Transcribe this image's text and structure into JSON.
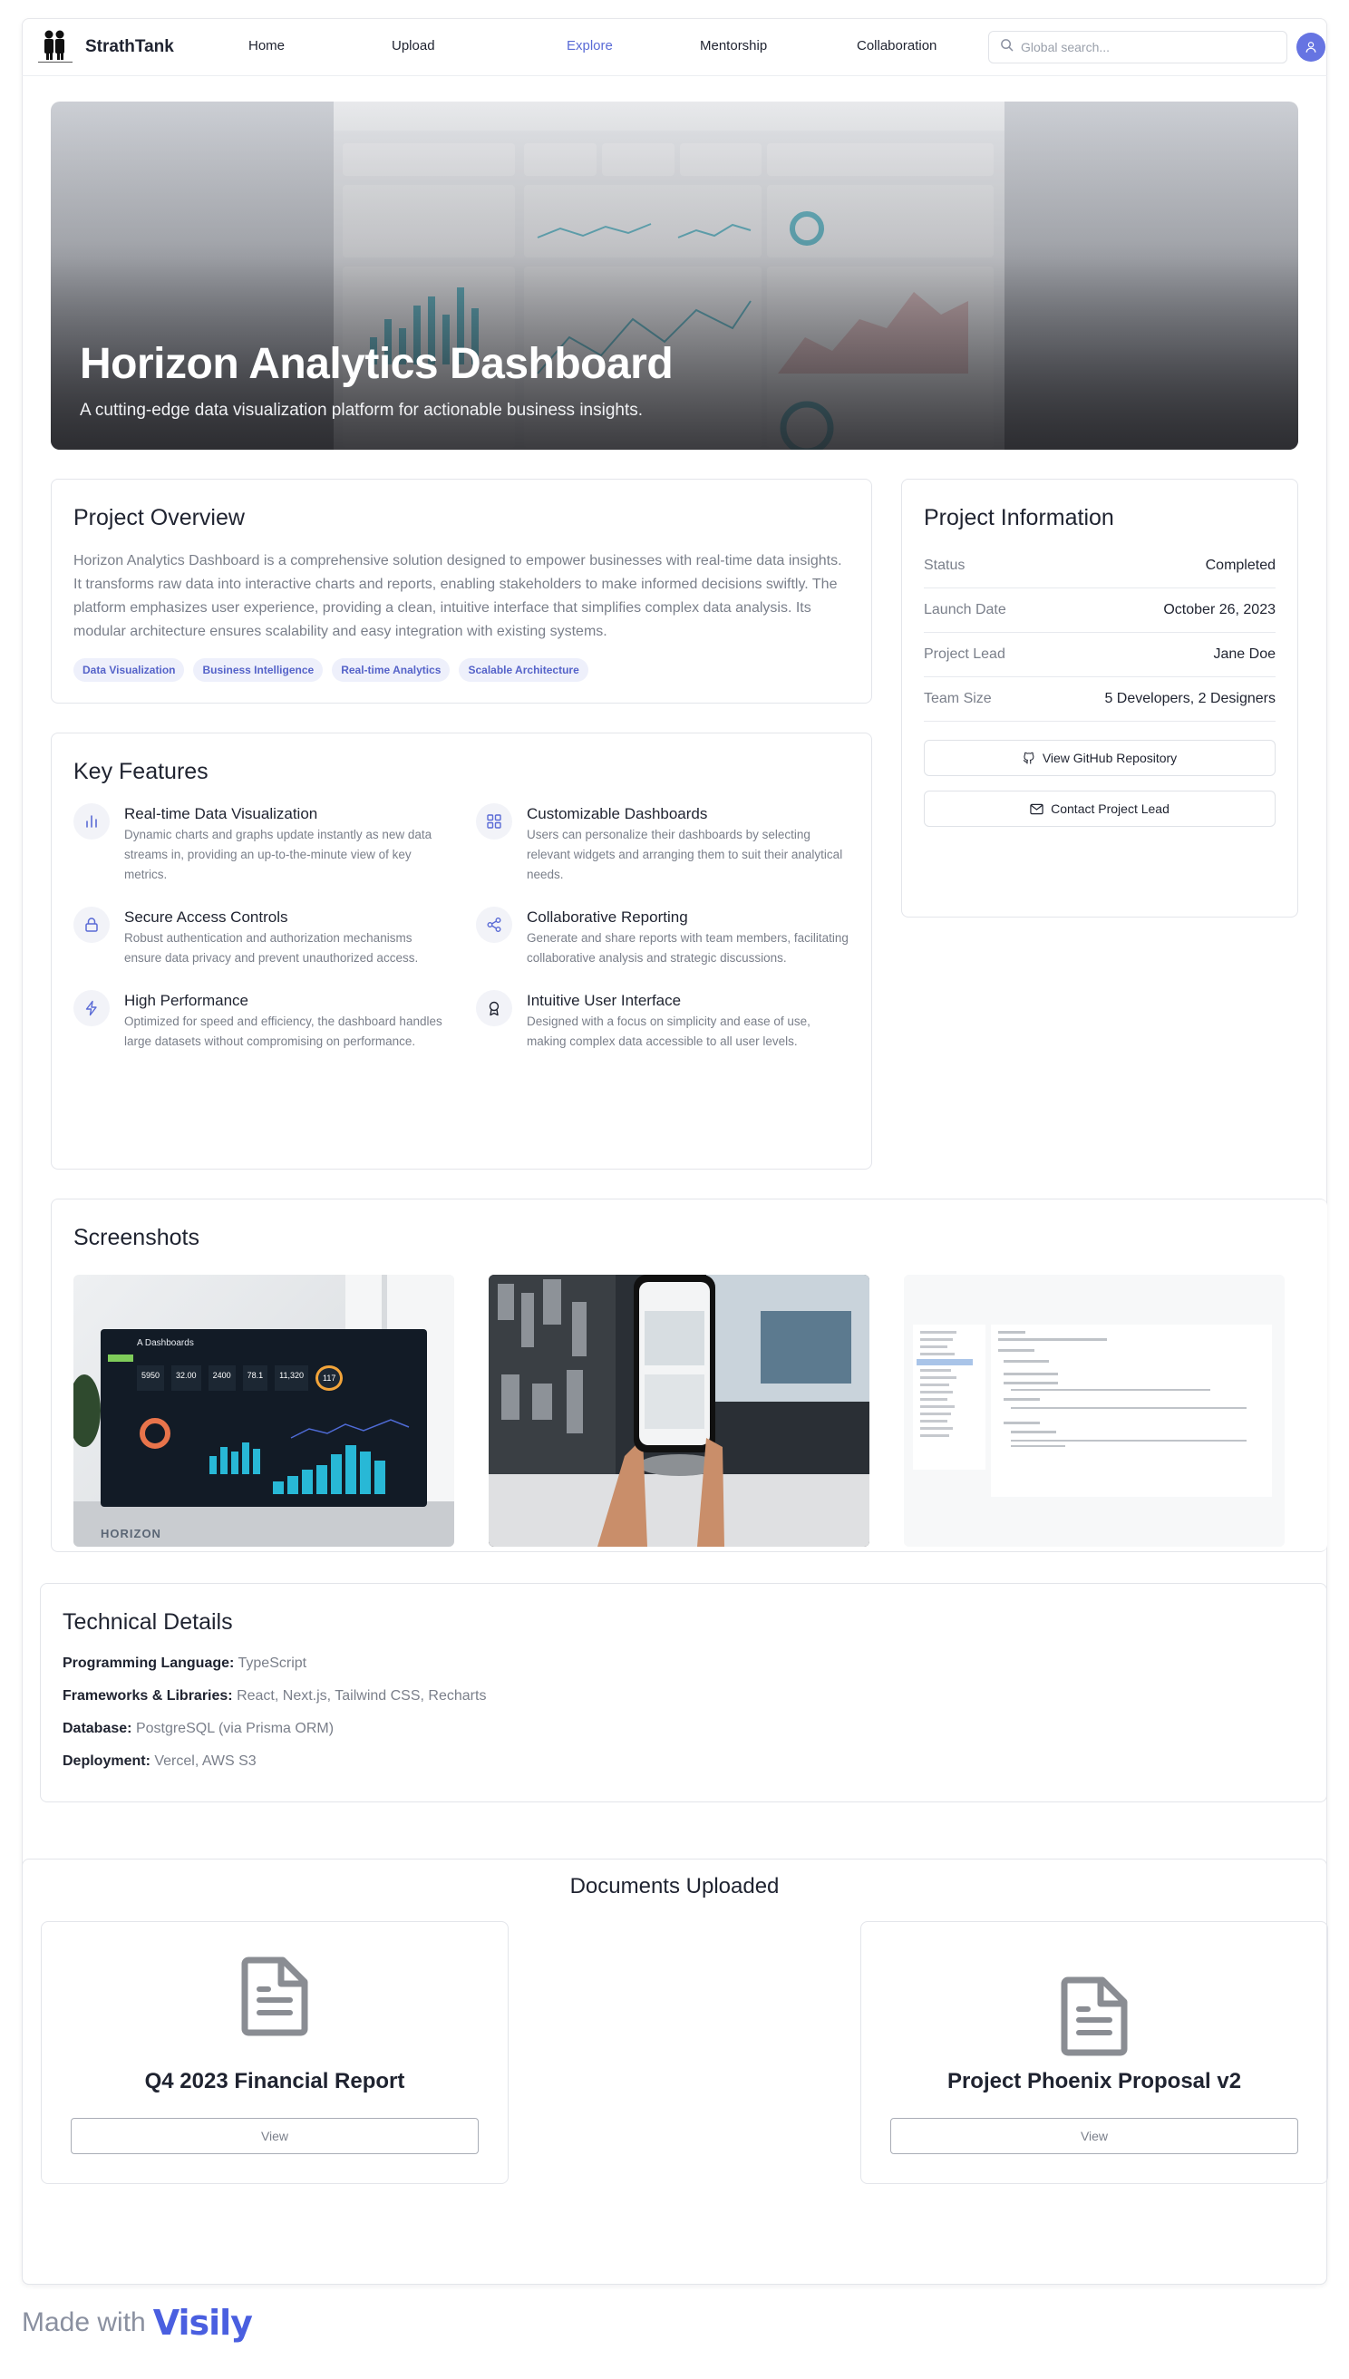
{
  "nav": {
    "brand": "StrathTank",
    "links": [
      {
        "label": "Home"
      },
      {
        "label": "Upload"
      },
      {
        "label": "Explore",
        "active": true
      },
      {
        "label": "Mentorship"
      },
      {
        "label": "Collaboration"
      }
    ],
    "search_placeholder": "Global search..."
  },
  "hero": {
    "title": "Horizon Analytics Dashboard",
    "subtitle": "A cutting-edge data visualization platform for actionable business insights."
  },
  "overview": {
    "title": "Project Overview",
    "text": "Horizon Analytics Dashboard is a comprehensive solution designed to empower businesses with real-time data insights. It transforms raw data into interactive charts and reports, enabling stakeholders to make informed decisions swiftly. The platform emphasizes user experience, providing a clean, intuitive interface that simplifies complex data analysis. Its modular architecture ensures scalability and easy integration with existing systems.",
    "tags": [
      "Data Visualization",
      "Business Intelligence",
      "Real-time Analytics",
      "Scalable Architecture"
    ]
  },
  "info": {
    "title": "Project Information",
    "rows": [
      {
        "k": "Status",
        "v": "Completed"
      },
      {
        "k": "Launch Date",
        "v": "October 26, 2023"
      },
      {
        "k": "Project Lead",
        "v": "Jane Doe"
      },
      {
        "k": "Team Size",
        "v": "5 Developers, 2 Designers"
      }
    ],
    "github_label": "View GitHub Repository",
    "contact_label": "Contact Project Lead"
  },
  "features": {
    "title": "Key Features",
    "items": [
      {
        "title": "Real-time Data Visualization",
        "desc": "Dynamic charts and graphs update instantly as new data streams in, providing an up-to-the-minute view of key metrics.",
        "icon": "bar-chart-icon"
      },
      {
        "title": "Customizable Dashboards",
        "desc": "Users can personalize their dashboards by selecting relevant widgets and arranging them to suit their analytical needs.",
        "icon": "grid-icon"
      },
      {
        "title": "Secure Access Controls",
        "desc": "Robust authentication and authorization mechanisms ensure data privacy and prevent unauthorized access.",
        "icon": "lock-icon"
      },
      {
        "title": "Collaborative Reporting",
        "desc": "Generate and share reports with team members, facilitating collaborative analysis and strategic discussions.",
        "icon": "share-icon"
      },
      {
        "title": "High Performance",
        "desc": "Optimized for speed and efficiency, the dashboard handles large datasets without compromising on performance.",
        "icon": "lightning-icon"
      },
      {
        "title": "Intuitive User Interface",
        "desc": "Designed with a focus on simplicity and ease of use, making complex data accessible to all user levels.",
        "icon": "award-icon"
      }
    ]
  },
  "screenshots": {
    "title": "Screenshots",
    "shot1_brand": "HORIZON",
    "shot1_header": "A Dashboards",
    "shot1_nums": [
      "5950",
      "32.00",
      "2400",
      "78.1",
      "11,320",
      "117"
    ]
  },
  "tech": {
    "title": "Technical Details",
    "rows": [
      {
        "k": "Programming Language:",
        "v": "TypeScript"
      },
      {
        "k": "Frameworks & Libraries:",
        "v": "React, Next.js, Tailwind CSS, Recharts"
      },
      {
        "k": "Database:",
        "v": "PostgreSQL (via Prisma ORM)"
      },
      {
        "k": "Deployment:",
        "v": "Vercel, AWS S3"
      }
    ]
  },
  "documents": {
    "title": "Documents Uploaded",
    "items": [
      {
        "name": "Q4 2023 Financial Report",
        "button": "View"
      },
      {
        "name": "Project Phoenix Proposal v2",
        "button": "View"
      }
    ]
  },
  "footer": {
    "made_with": "Made with",
    "brand": "Visily"
  },
  "colors": {
    "accent": "#5a6bd6",
    "tag_bg": "#eef0fb",
    "muted_text": "#7a7f8a"
  }
}
